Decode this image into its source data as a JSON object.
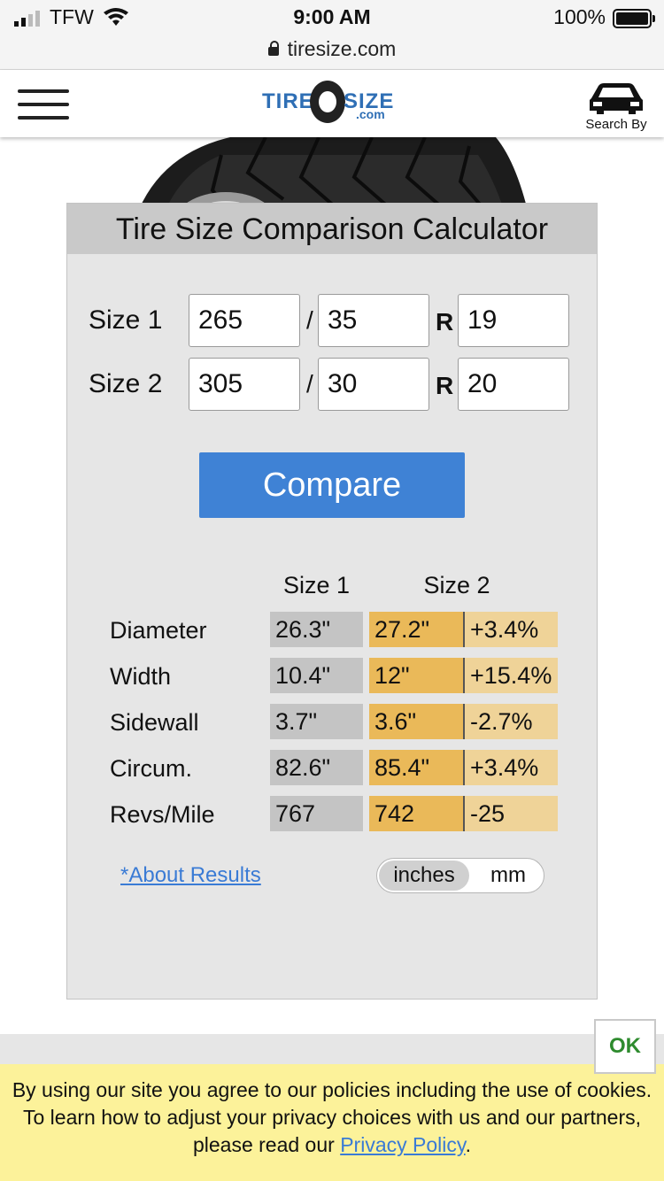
{
  "status_bar": {
    "carrier": "TFW",
    "time": "9:00 AM",
    "battery": "100%",
    "url": "tiresize.com"
  },
  "header": {
    "logo_tire": "TIRE",
    "logo_size": "SIZE",
    "logo_com": ".com",
    "search_by_label": "Search By"
  },
  "calculator": {
    "title": "Tire Size Comparison Calculator",
    "rows": [
      {
        "label": "Size 1",
        "width": "265",
        "aspect": "35",
        "rim": "19"
      },
      {
        "label": "Size 2",
        "width": "305",
        "aspect": "30",
        "rim": "20"
      }
    ],
    "slash": "/",
    "r": "R",
    "compare_label": "Compare",
    "col_size1": "Size 1",
    "col_size2": "Size 2",
    "results": [
      {
        "label": "Diameter",
        "s1": "26.3\"",
        "s2": "27.2\"",
        "diff": "+3.4%"
      },
      {
        "label": "Width",
        "s1": "10.4\"",
        "s2": "12\"",
        "diff": "+15.4%"
      },
      {
        "label": "Sidewall",
        "s1": "3.7\"",
        "s2": "3.6\"",
        "diff": "-2.7%"
      },
      {
        "label": "Circum.",
        "s1": "82.6\"",
        "s2": "85.4\"",
        "diff": "+3.4%"
      },
      {
        "label": "Revs/Mile",
        "s1": "767",
        "s2": "742",
        "diff": "-25"
      }
    ],
    "about_link": "*About Results",
    "unit_inches": "inches",
    "unit_mm": "mm"
  },
  "cookie_banner": {
    "text_before": "By using our site you agree to our policies including the use of cookies. To learn how to adjust your privacy choices with us and our partners, please read our ",
    "link": "Privacy Policy",
    "text_after": ".",
    "ok_label": "OK"
  },
  "colors": {
    "accent_blue": "#3f82d5",
    "size2_cell": "#eab959",
    "diff_cell": "#efd398",
    "size1_cell": "#c4c4c4",
    "cookie_bg": "#fcf29a",
    "ok_green": "#2e8b2e"
  }
}
